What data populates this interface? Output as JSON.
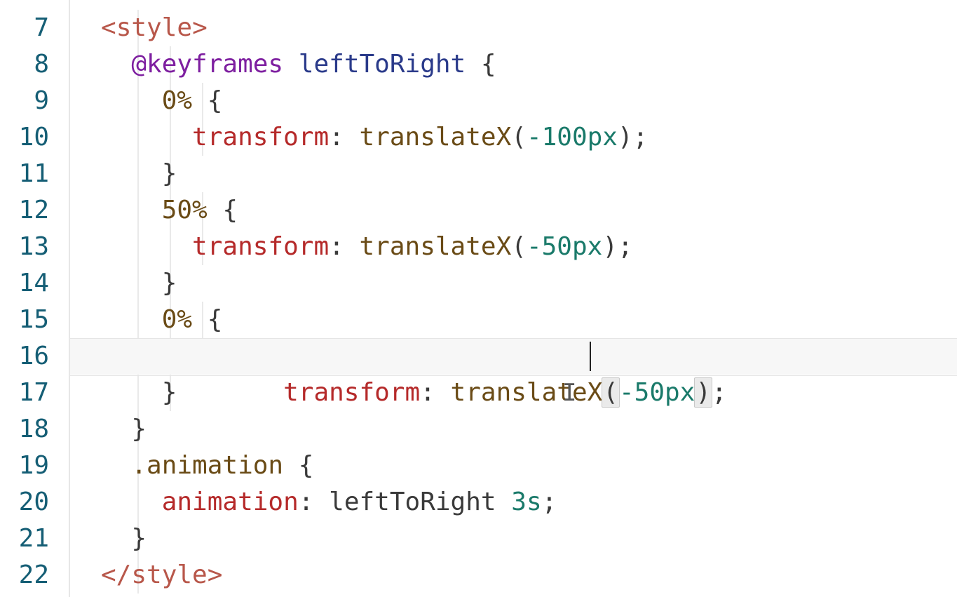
{
  "line_numbers": [
    "7",
    "8",
    "9",
    "10",
    "11",
    "12",
    "13",
    "14",
    "15",
    "16",
    "17",
    "18",
    "19",
    "20",
    "21",
    "22"
  ],
  "tokens": {
    "style_open_lt": "<",
    "style_open_name": "style",
    "style_open_gt": ">",
    "style_close_lt": "</",
    "style_close_name": "style",
    "style_close_gt": ">",
    "at_keyframes": "@keyframes",
    "kf_name": "leftToRight",
    "brace_open": "{",
    "brace_close": "}",
    "pct0": "0%",
    "pct50": "50%",
    "prop_transform": "transform",
    "colon": ":",
    "semicolon": ";",
    "fn_translateX": "translateX",
    "paren_open": "(",
    "paren_close": ")",
    "val_m100px": "-100px",
    "val_m50px": "-50px",
    "sel_animation": ".animation",
    "prop_animation": "animation",
    "val_leftToRight": "leftToRight",
    "val_3s": "3s",
    "space": " "
  },
  "cursor_icon": "I"
}
